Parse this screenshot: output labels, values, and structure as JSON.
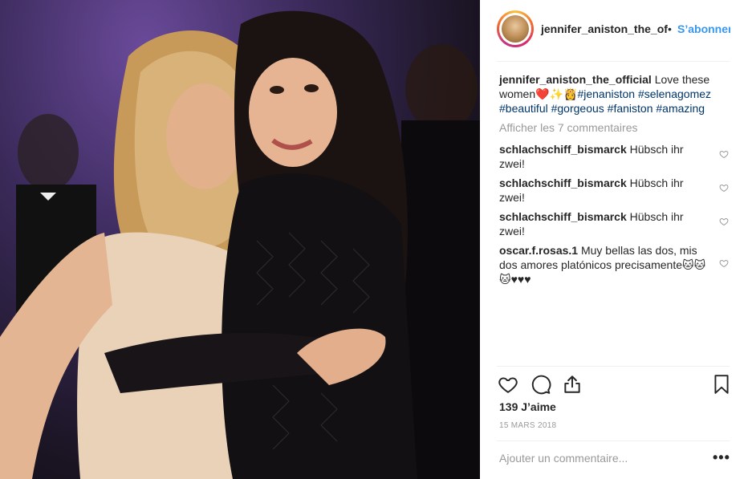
{
  "header": {
    "username": "jennifer_aniston_the_of",
    "separator": "•",
    "follow_label": "S’abonner"
  },
  "caption": {
    "username": "jennifer_aniston_the_official",
    "text": "Love these women",
    "emojis": "❤️✨👸",
    "tags": [
      "#jenaniston",
      "#selenagomez",
      "#beautiful",
      "#gorgeous",
      "#faniston",
      "#amazing"
    ]
  },
  "show_comments_label": "Afficher les 7 commentaires",
  "comments": [
    {
      "username": "schlachschiff_bismarck",
      "text": "Hübsch ihr zwei!"
    },
    {
      "username": "schlachschiff_bismarck",
      "text": "Hübsch ihr zwei!"
    },
    {
      "username": "schlachschiff_bismarck",
      "text": "Hübsch ihr zwei!"
    },
    {
      "username": "oscar.f.rosas.1",
      "text": "Muy bellas las dos, mis dos amores platónicos precisamente🐱🐱🐱♥♥♥"
    }
  ],
  "likes": "139 J’aime",
  "date": "15 MARS 2018",
  "add_comment_placeholder": "Ajouter un commentaire...",
  "more_label": "•••",
  "colors": {
    "link_blue": "#3897f0",
    "hashtag": "#003569",
    "muted": "#999999",
    "text": "#262626"
  },
  "icons": [
    "heart-icon",
    "comment-icon",
    "share-icon",
    "bookmark-icon",
    "more-options-icon"
  ]
}
